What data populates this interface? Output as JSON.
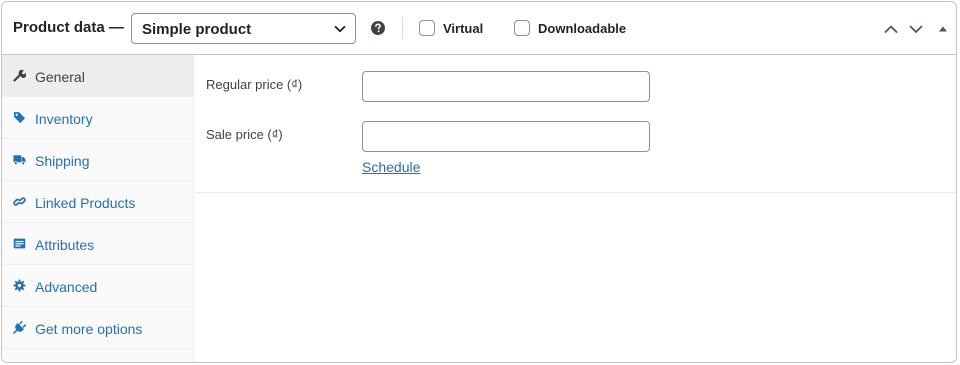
{
  "header": {
    "title": "Product data —",
    "product_type": {
      "selected": "Simple product"
    },
    "help_icon": "help-circle-icon",
    "virtual_label": "Virtual",
    "virtual_checked": false,
    "downloadable_label": "Downloadable",
    "downloadable_checked": false,
    "controls": [
      "chevron-up-icon",
      "chevron-down-icon",
      "triangle-up-icon"
    ]
  },
  "tabs": [
    {
      "label": "General",
      "icon": "wrench-icon",
      "active": true
    },
    {
      "label": "Inventory",
      "icon": "tag-icon",
      "active": false
    },
    {
      "label": "Shipping",
      "icon": "truck-icon",
      "active": false
    },
    {
      "label": "Linked Products",
      "icon": "link-icon",
      "active": false
    },
    {
      "label": "Attributes",
      "icon": "list-icon",
      "active": false
    },
    {
      "label": "Advanced",
      "icon": "gear-icon",
      "active": false
    },
    {
      "label": "Get more options",
      "icon": "plugin-icon",
      "active": false
    }
  ],
  "general": {
    "regular_price_label": "Regular price (₫)",
    "regular_price_value": "",
    "sale_price_label": "Sale price (₫)",
    "sale_price_value": "",
    "schedule_link": "Schedule"
  },
  "colors": {
    "link": "#2271b1",
    "text": "#1d2327",
    "border": "#c3c4c7",
    "tab_active_bg": "#eeeeee",
    "tab_bg": "#fafafa"
  }
}
